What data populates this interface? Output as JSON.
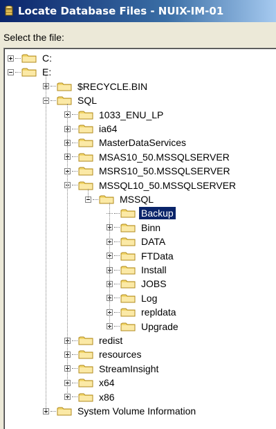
{
  "window": {
    "title": "Locate Database Files - NUIX-IM-01"
  },
  "prompt": "Select the file:",
  "colors": {
    "selection": "#0a246a",
    "folder": "#f2d66b",
    "folder_edge": "#b08a1e"
  },
  "tree": [
    {
      "label": "C:",
      "level": 0,
      "expander": "plus"
    },
    {
      "label": "E:",
      "level": 0,
      "expander": "minus"
    },
    {
      "label": "$RECYCLE.BIN",
      "level": 1,
      "expander": "plus"
    },
    {
      "label": "SQL",
      "level": 1,
      "expander": "minus"
    },
    {
      "label": "1033_ENU_LP",
      "level": 2,
      "expander": "plus"
    },
    {
      "label": "ia64",
      "level": 2,
      "expander": "plus"
    },
    {
      "label": "MasterDataServices",
      "level": 2,
      "expander": "plus"
    },
    {
      "label": "MSAS10_50.MSSQLSERVER",
      "level": 2,
      "expander": "plus"
    },
    {
      "label": "MSRS10_50.MSSQLSERVER",
      "level": 2,
      "expander": "plus"
    },
    {
      "label": "MSSQL10_50.MSSQLSERVER",
      "level": 2,
      "expander": "minus"
    },
    {
      "label": "MSSQL",
      "level": 3,
      "expander": "minus"
    },
    {
      "label": "Backup",
      "level": 4,
      "expander": "none",
      "selected": true
    },
    {
      "label": "Binn",
      "level": 4,
      "expander": "plus"
    },
    {
      "label": "DATA",
      "level": 4,
      "expander": "plus"
    },
    {
      "label": "FTData",
      "level": 4,
      "expander": "plus"
    },
    {
      "label": "Install",
      "level": 4,
      "expander": "plus"
    },
    {
      "label": "JOBS",
      "level": 4,
      "expander": "plus"
    },
    {
      "label": "Log",
      "level": 4,
      "expander": "plus"
    },
    {
      "label": "repldata",
      "level": 4,
      "expander": "plus"
    },
    {
      "label": "Upgrade",
      "level": 4,
      "expander": "plus"
    },
    {
      "label": "redist",
      "level": 2,
      "expander": "plus"
    },
    {
      "label": "resources",
      "level": 2,
      "expander": "plus"
    },
    {
      "label": "StreamInsight",
      "level": 2,
      "expander": "plus"
    },
    {
      "label": "x64",
      "level": 2,
      "expander": "plus"
    },
    {
      "label": "x86",
      "level": 2,
      "expander": "plus"
    },
    {
      "label": "System Volume Information",
      "level": 1,
      "expander": "plus"
    }
  ]
}
